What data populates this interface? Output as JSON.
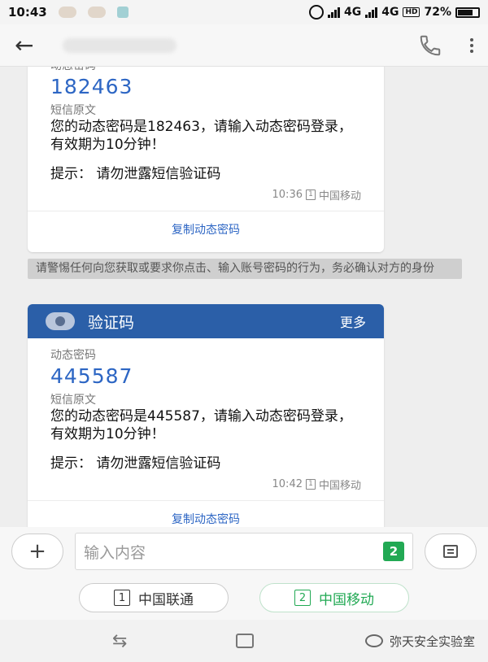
{
  "statusbar": {
    "time": "10:43",
    "net1": "4G",
    "net2": "4G",
    "hd": "HD",
    "battery": "72%"
  },
  "appbar": {
    "contact": ""
  },
  "cards": [
    {
      "code_label": "动态密码",
      "code": "182463",
      "orig_label": "短信原文",
      "message": "您的动态密码是182463，请输入动态密码登录，有效期为10分钟！",
      "hint": "提示：  请勿泄露短信验证码",
      "time": "10:36",
      "sim_num": "1",
      "carrier": "中国移动",
      "copy": "复制动态密码"
    },
    {
      "header_title": "验证码",
      "header_more": "更多",
      "code_label": "动态密码",
      "code": "445587",
      "orig_label": "短信原文",
      "message": "您的动态密码是445587，请输入动态密码登录，有效期为10分钟！",
      "hint": "提示：  请勿泄露短信验证码",
      "time": "10:42",
      "sim_num": "1",
      "carrier": "中国移动",
      "copy": "复制动态密码"
    }
  ],
  "warning": "请警惕任何向您获取或要求你点击、输入账号密码的行为，务必确认对方的身份",
  "input": {
    "placeholder": "输入内容",
    "sim_badge": "2"
  },
  "sim_buttons": [
    {
      "num": "1",
      "label": "中国联通"
    },
    {
      "num": "2",
      "label": "中国移动"
    }
  ],
  "watermark": "弥天安全实验室",
  "colors": {
    "accent": "#2d66c4",
    "header": "#2b5fa8",
    "sim_active": "#22a954"
  }
}
